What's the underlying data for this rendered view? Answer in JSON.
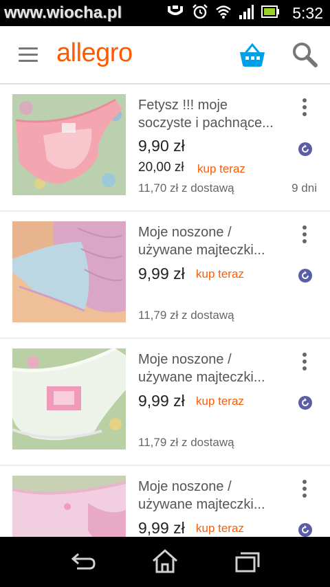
{
  "status_bar": {
    "watermark": "www.wiocha.pl",
    "time": "5:32",
    "icons": [
      "usb-debug-icon",
      "alarm-icon",
      "wifi-icon",
      "signal-icon",
      "battery-icon"
    ]
  },
  "app_bar": {
    "logo": "allegro",
    "icons": [
      "menu-icon",
      "basket-icon",
      "search-icon"
    ],
    "accent_color": "#ff5a00",
    "basket_color": "#00a0e8"
  },
  "listing": {
    "items": [
      {
        "title_line1": "Fetysz !!! moje",
        "title_line2": "soczyste i pachnące...",
        "price": "9,90 zł",
        "buy_price": "20,00 zł",
        "buy_now": "kup teraz",
        "delivery": "11,70 zł z dostawą",
        "days": "9 dni"
      },
      {
        "title_line1": "Moje noszone /",
        "title_line2": "używane majteczki...",
        "price": "9,99 zł",
        "buy_now": "kup teraz",
        "delivery": "11,79 zł z dostawą"
      },
      {
        "title_line1": "Moje noszone /",
        "title_line2": "używane majteczki...",
        "price": "9,99 zł",
        "buy_now": "kup teraz",
        "delivery": "11,79 zł z dostawą"
      },
      {
        "title_line1": "Moje noszone /",
        "title_line2": "używane majteczki...",
        "price": "9,99 zł",
        "buy_now": "kup teraz"
      }
    ]
  },
  "nav_bar": {
    "icons": [
      "back-icon",
      "home-icon",
      "recent-apps-icon"
    ]
  }
}
